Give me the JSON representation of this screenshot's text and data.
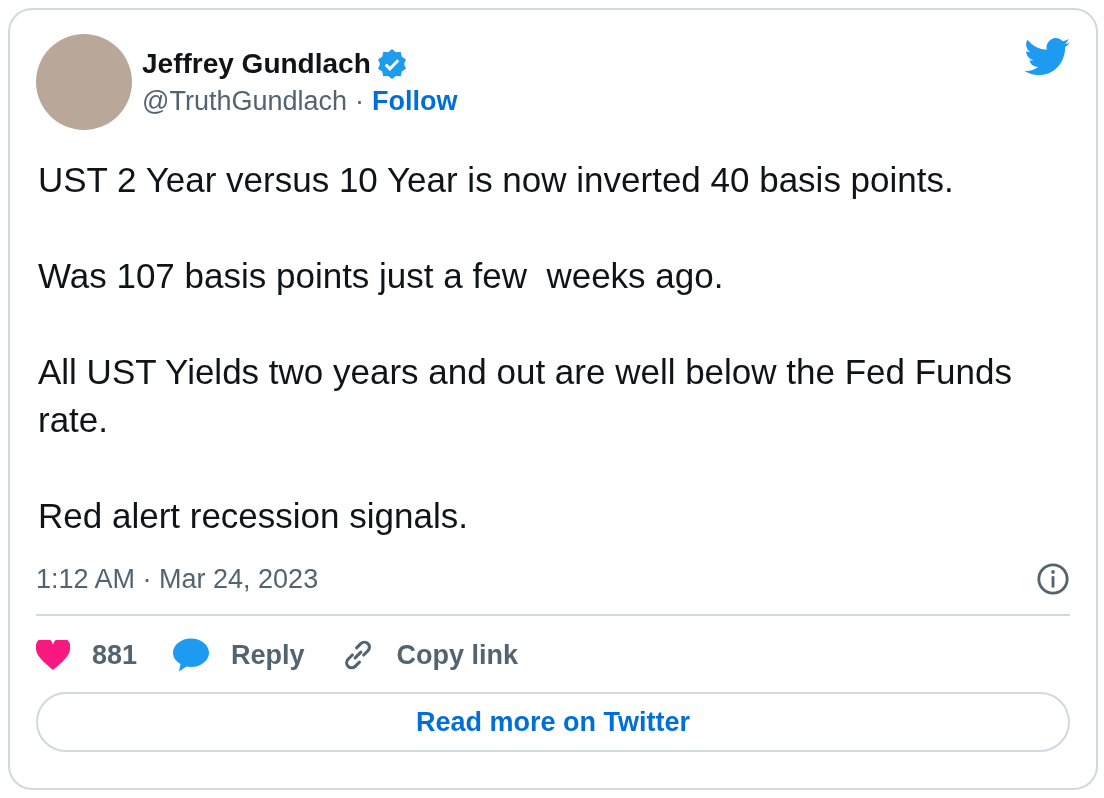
{
  "author": {
    "name": "Jeffrey Gundlach",
    "verified": true,
    "handle": "@TruthGundlach",
    "separator": "·",
    "follow": "Follow"
  },
  "paragraphs": [
    "UST 2 Year versus 10 Year is now inverted 40 basis points.",
    "Was 107 basis points just a few  weeks ago.",
    "All UST Yields two years and out are well below the Fed Funds rate.",
    "Red alert recession signals."
  ],
  "timestamp": "1:12 AM · Mar 24, 2023",
  "actions": [
    {
      "kind": "like",
      "label": "881"
    },
    {
      "kind": "reply",
      "label": "Reply"
    },
    {
      "kind": "copy",
      "label": "Copy link"
    }
  ],
  "read_more": "Read more on Twitter"
}
